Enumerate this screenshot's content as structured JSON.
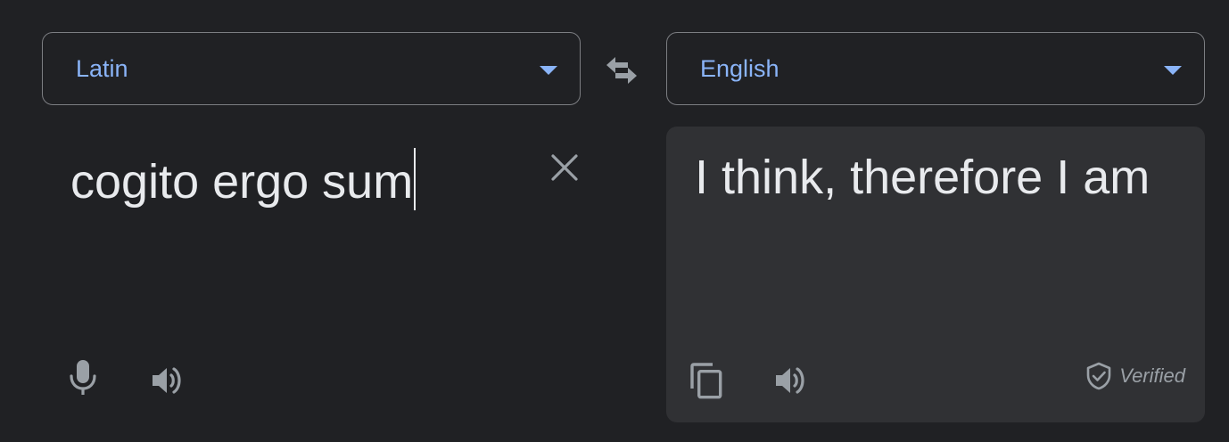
{
  "source_lang": {
    "label": "Latin",
    "icon": "chevron-down-icon"
  },
  "target_lang": {
    "label": "English",
    "icon": "chevron-down-icon"
  },
  "swap": {
    "icon": "swap-arrows-icon"
  },
  "source": {
    "text": "cogito ergo sum",
    "clear_icon": "close-icon",
    "mic_icon": "microphone-icon",
    "speaker_icon": "speaker-icon"
  },
  "target": {
    "text": "I think, therefore I am",
    "copy_icon": "copy-icon",
    "speaker_icon": "speaker-icon",
    "verified_label": "Verified",
    "verified_icon": "verified-shield-icon"
  },
  "colors": {
    "background": "#202124",
    "panel": "#303134",
    "accent": "#8ab4f8",
    "text": "#e8eaed",
    "icon": "#9aa0a6"
  }
}
